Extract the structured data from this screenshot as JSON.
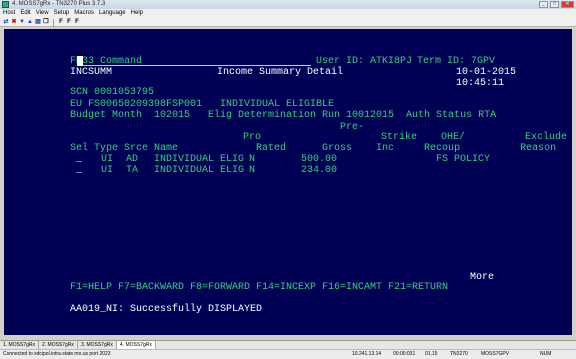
{
  "window": {
    "title": "4. MOSS7gRx - TN3270 Plus 3.7.3",
    "minimize": "_",
    "maximize": "□",
    "close": "✕"
  },
  "menu": [
    "Host",
    "Edit",
    "View",
    "Setup",
    "Macros",
    "Language",
    "Help"
  ],
  "toolbar": {
    "pf_buttons": [
      "F",
      "F",
      "F"
    ]
  },
  "terminal": {
    "command_label": "FM33 Command",
    "user_id": "User ID: ATKI8PJ",
    "term_id": "Term ID: 7GPV",
    "screen_id": "INCSUMM",
    "screen_title": "Income Summary Detail",
    "date": "10-01-2015",
    "time": "10:45:11",
    "scn": "SCN 0001053795",
    "eu": "EU FS00650209398FSP001   INDIVIDUAL ELIGIBLE",
    "budget": "Budget Month  102015   Elig Determination Run 10012015  Auth Status RTA",
    "col_header_1": "Pre-",
    "col_header_2": "Pro                    Strike    OHE/          Exclude",
    "col_header_3": "Sel Type Srce Name             Rated      Gross    Inc     Recoup          Reason",
    "rows": [
      {
        "sel": "_",
        "type": "UI",
        "srce": "AD",
        "name": "INDIVIDUAL ELIG",
        "rated": "N",
        "gross": "500.00",
        "reason": "FS POLICY"
      },
      {
        "sel": "_",
        "type": "UI",
        "srce": "TA",
        "name": "INDIVIDUAL ELIG",
        "rated": "N",
        "gross": "234.00",
        "reason": ""
      }
    ],
    "more": "More",
    "pf_keys": "F1=HELP F7=BACKWARD F8=FORWARD F14=INCEXP F16=INCAMT F21=RETURN",
    "message": "AA019_NI: Successfully DISPLAYED"
  },
  "session_tabs": [
    "1. MOSS7gRx",
    "2. MOSS7gRx",
    "3. MOSS7gRx",
    "4. MOSS7gRx"
  ],
  "status": {
    "connection": "Connected to sdcipol.intra.state.mo.us port 2023",
    "ip": "10.241.13.14",
    "counter": "00:00:031",
    "cursor": "01,15",
    "lu": "TN3270",
    "session": "MOSS7GPV",
    "num": "NUM"
  }
}
